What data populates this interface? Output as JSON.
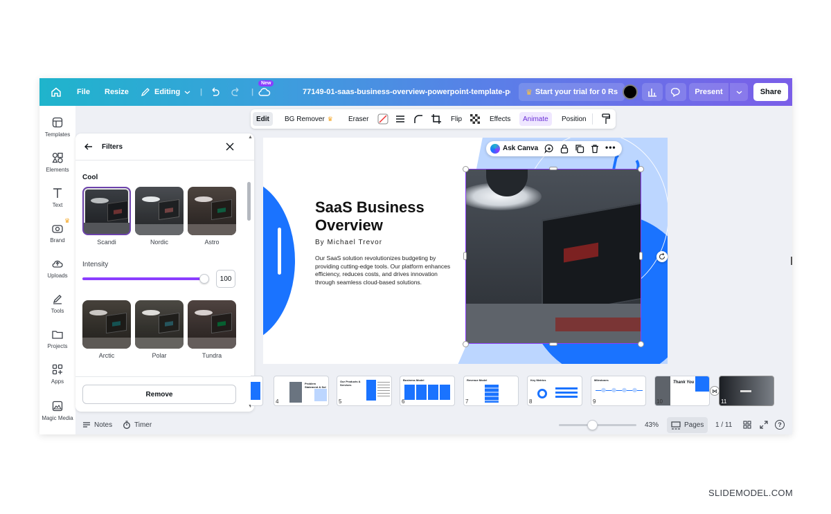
{
  "topbar": {
    "file": "File",
    "resize": "Resize",
    "editing": "Editing",
    "new_badge": "New",
    "doc_title": "77149-01-saas-business-overview-powerpoint-template-po...",
    "trial": "Start your trial for 0 Rs",
    "present": "Present",
    "share": "Share"
  },
  "sidebar": {
    "items": [
      {
        "label": "Templates",
        "icon": "templates-icon"
      },
      {
        "label": "Elements",
        "icon": "elements-icon"
      },
      {
        "label": "Text",
        "icon": "text-icon"
      },
      {
        "label": "Brand",
        "icon": "brand-icon"
      },
      {
        "label": "Uploads",
        "icon": "uploads-icon"
      },
      {
        "label": "Tools",
        "icon": "tools-icon"
      },
      {
        "label": "Projects",
        "icon": "projects-icon"
      },
      {
        "label": "Apps",
        "icon": "apps-icon"
      },
      {
        "label": "Magic Media",
        "icon": "magic-media-icon"
      }
    ]
  },
  "panel": {
    "title": "Filters",
    "section": "Cool",
    "filters_row1": [
      "Scandi",
      "Nordic",
      "Astro"
    ],
    "filters_row2": [
      "Arctic",
      "Polar",
      "Tundra"
    ],
    "intensity_label": "Intensity",
    "intensity_value": "100",
    "intensity_fraction": 1.0,
    "remove": "Remove"
  },
  "context_toolbar": {
    "edit": "Edit",
    "bg_remover": "BG Remover",
    "eraser": "Eraser",
    "flip": "Flip",
    "effects": "Effects",
    "animate": "Animate",
    "position": "Position"
  },
  "floating": {
    "ask_canva": "Ask Canva"
  },
  "slide": {
    "title_line1": "SaaS Business",
    "title_line2": "Overview",
    "author": "By Michael Trevor",
    "body": "Our SaaS solution revolutionizes budgeting by providing cutting-edge tools. Our platform enhances efficiency, reduces costs, and drives innovation through seamless cloud-based solutions."
  },
  "filmstrip": {
    "pages": [
      {
        "n": "4",
        "title": "Problem Statement & Sol"
      },
      {
        "n": "5",
        "title": "Our Products & Services"
      },
      {
        "n": "6",
        "title": "Business Model"
      },
      {
        "n": "7",
        "title": "Revenue Model"
      },
      {
        "n": "8",
        "title": "Key Metrics"
      },
      {
        "n": "9",
        "title": "Milestones"
      },
      {
        "n": "10",
        "title": "Thank You"
      },
      {
        "n": "11",
        "title": ""
      }
    ]
  },
  "bottom": {
    "notes": "Notes",
    "timer": "Timer",
    "zoom": "43%",
    "zoom_fraction": 0.43,
    "pages": "Pages",
    "page_count": "1 / 11"
  },
  "watermark": "SLIDEMODEL.COM",
  "colors": {
    "accent_purple": "#8b3dff",
    "brand_blue": "#1a73ff",
    "light_blue": "#bcd6ff"
  }
}
